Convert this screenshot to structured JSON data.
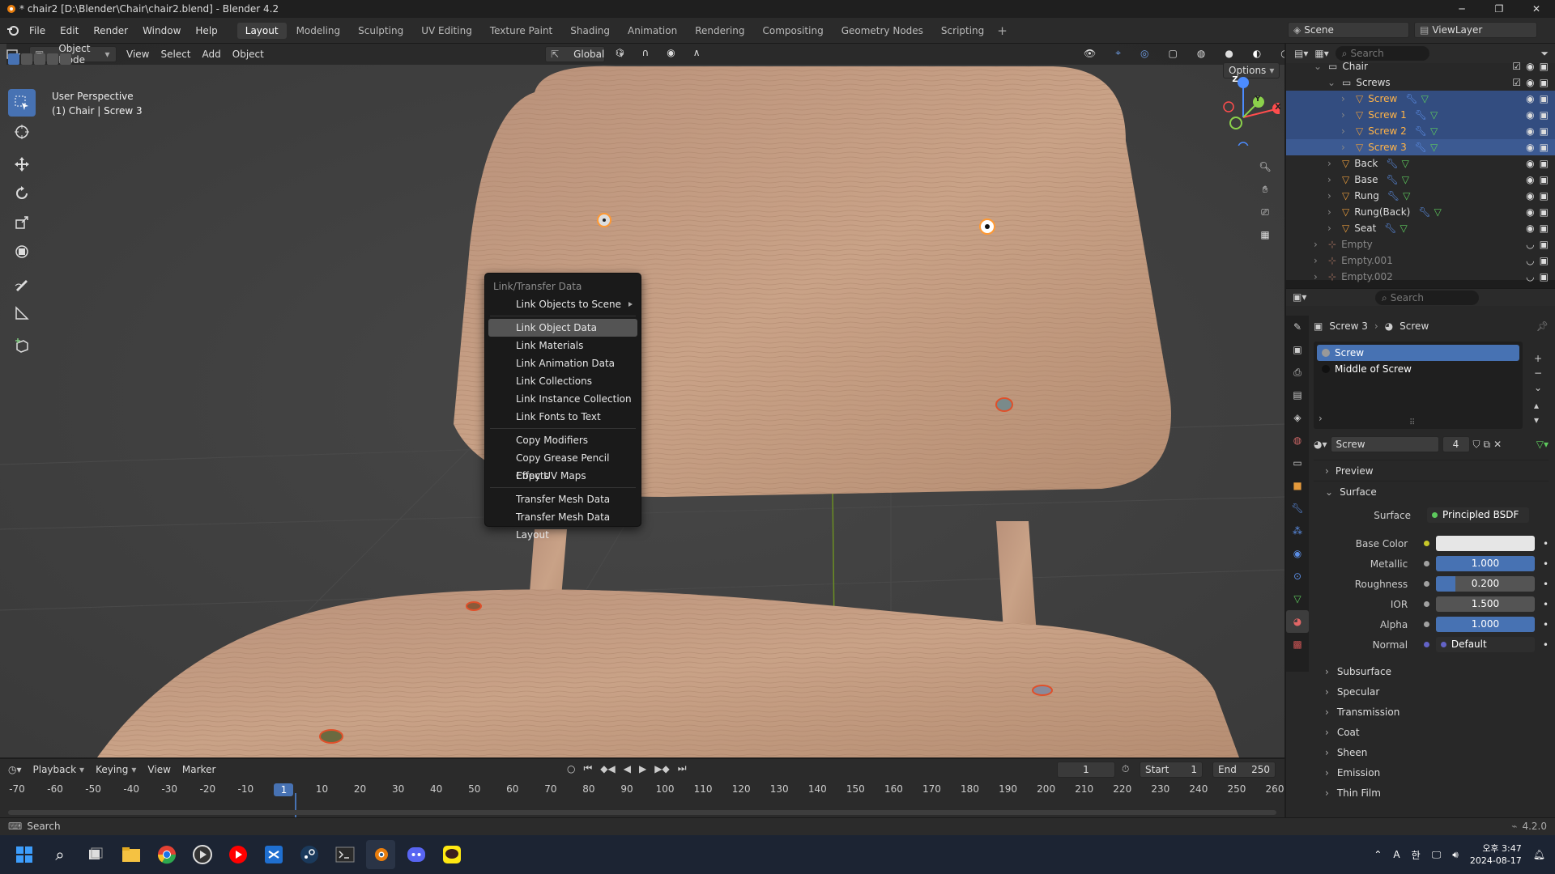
{
  "window": {
    "title": "* chair2 [D:\\Blender\\Chair\\chair2.blend] - Blender 4.2"
  },
  "menu": [
    "File",
    "Edit",
    "Render",
    "Window",
    "Help"
  ],
  "workspaces": [
    "Layout",
    "Modeling",
    "Sculpting",
    "UV Editing",
    "Texture Paint",
    "Shading",
    "Animation",
    "Rendering",
    "Compositing",
    "Geometry Nodes",
    "Scripting"
  ],
  "active_workspace": "Layout",
  "scene": {
    "name": "Scene",
    "view_layer": "ViewLayer"
  },
  "viewport_header": {
    "mode": "Object Mode",
    "menus": [
      "View",
      "Select",
      "Add",
      "Object"
    ],
    "transform": "Global",
    "options_label": "Options"
  },
  "viewport_info": {
    "line1": "User Perspective",
    "line2": "(1) Chair | Screw 3"
  },
  "gizmo": {
    "z": "Z",
    "y": "Y",
    "x": "X"
  },
  "context_menu": {
    "title": "Link/Transfer Data",
    "groups": [
      [
        {
          "label": "Link Objects to Scene",
          "submenu": true
        }
      ],
      [
        {
          "label": "Link Object Data",
          "highlight": true
        },
        {
          "label": "Link Materials"
        },
        {
          "label": "Link Animation Data"
        },
        {
          "label": "Link Collections"
        },
        {
          "label": "Link Instance Collection"
        },
        {
          "label": "Link Fonts to Text"
        }
      ],
      [
        {
          "label": "Copy Modifiers"
        },
        {
          "label": "Copy Grease Pencil Effects"
        },
        {
          "label": "Copy UV Maps"
        }
      ],
      [
        {
          "label": "Transfer Mesh Data"
        },
        {
          "label": "Transfer Mesh Data Layout"
        }
      ]
    ]
  },
  "outliner": {
    "search_placeholder": "Search",
    "rows": [
      {
        "name": "Chair",
        "indent": 2,
        "type": "collection",
        "state": ""
      },
      {
        "name": "Screws",
        "indent": 3,
        "type": "collection",
        "state": ""
      },
      {
        "name": "Screw",
        "indent": 4,
        "type": "mesh",
        "state": "sel"
      },
      {
        "name": "Screw 1",
        "indent": 4,
        "type": "mesh",
        "state": "sel"
      },
      {
        "name": "Screw 2",
        "indent": 4,
        "type": "mesh",
        "state": "sel"
      },
      {
        "name": "Screw 3",
        "indent": 4,
        "type": "mesh",
        "state": "act"
      },
      {
        "name": "Back",
        "indent": 3,
        "type": "mesh",
        "state": ""
      },
      {
        "name": "Base",
        "indent": 3,
        "type": "mesh",
        "state": ""
      },
      {
        "name": "Rung",
        "indent": 3,
        "type": "mesh",
        "state": ""
      },
      {
        "name": "Rung(Back)",
        "indent": 3,
        "type": "mesh",
        "state": ""
      },
      {
        "name": "Seat",
        "indent": 3,
        "type": "mesh",
        "state": ""
      },
      {
        "name": "Empty",
        "indent": 2,
        "type": "empty",
        "state": "dim"
      },
      {
        "name": "Empty.001",
        "indent": 2,
        "type": "empty",
        "state": "dim"
      },
      {
        "name": "Empty.002",
        "indent": 2,
        "type": "empty",
        "state": "dim"
      }
    ]
  },
  "properties": {
    "search_placeholder": "Search",
    "breadcrumb": {
      "object": "Screw 3",
      "material": "Screw"
    },
    "slots": [
      {
        "name": "Screw",
        "selected": true
      },
      {
        "name": "Middle of Screw",
        "selected": false
      }
    ],
    "material_name": "Screw",
    "material_users": "4",
    "panels": {
      "preview": "Preview",
      "surface": "Surface"
    },
    "surface": {
      "label": "Surface",
      "value": "Principled BSDF"
    },
    "fields": [
      {
        "label": "Base Color",
        "value": "",
        "type": "color",
        "dot": "#c7c729"
      },
      {
        "label": "Metallic",
        "value": "1.000",
        "fill": 1.0,
        "dot": "#a1a1a1"
      },
      {
        "label": "Roughness",
        "value": "0.200",
        "fill": 0.2,
        "dot": "#a1a1a1"
      },
      {
        "label": "IOR",
        "value": "1.500",
        "fill": 0,
        "dot": "#a1a1a1"
      },
      {
        "label": "Alpha",
        "value": "1.000",
        "fill": 1.0,
        "dot": "#a1a1a1"
      },
      {
        "label": "Normal",
        "value": "Default",
        "type": "link",
        "dot": "#6363c7"
      }
    ],
    "collapsed_panels": [
      "Subsurface",
      "Specular",
      "Transmission",
      "Coat",
      "Sheen",
      "Emission",
      "Thin Film"
    ]
  },
  "timeline": {
    "menus": [
      "Playback",
      "Keying",
      "View",
      "Marker"
    ],
    "current_frame": "1",
    "start_label": "Start",
    "start": "1",
    "end_label": "End",
    "end": "250",
    "ticks": [
      "-70",
      "-60",
      "-50",
      "-40",
      "-30",
      "-20",
      "-10",
      "1",
      "10",
      "20",
      "30",
      "40",
      "50",
      "60",
      "70",
      "80",
      "90",
      "100",
      "110",
      "120",
      "130",
      "140",
      "150",
      "160",
      "170",
      "180",
      "190",
      "200",
      "210",
      "220",
      "230",
      "240",
      "250",
      "260"
    ]
  },
  "statusbar": {
    "left": "Search",
    "version": "4.2.0"
  },
  "taskbar": {
    "time": "오후 3:47",
    "date": "2024-08-17",
    "lang": "A",
    "ime": "한"
  },
  "colors": {
    "accent": "#4772b3",
    "selection": "#334d80",
    "highlight_text": "#ffb347",
    "wood": "#c49b7a"
  }
}
